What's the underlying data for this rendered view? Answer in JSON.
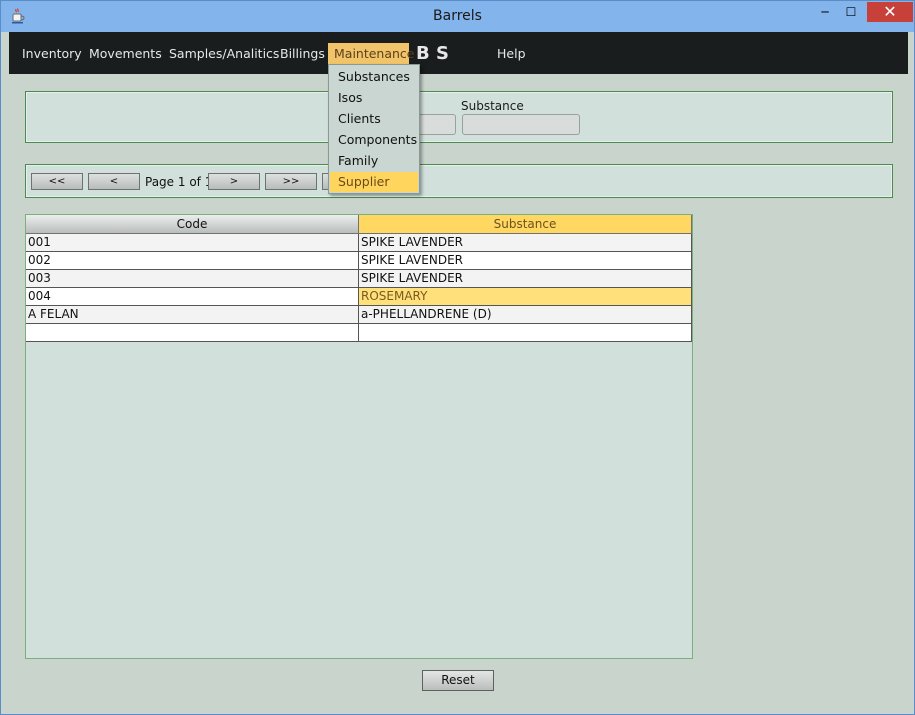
{
  "window": {
    "title": "Barrels",
    "minimize_glyph": "─",
    "maximize_glyph": "☐",
    "close_glyph": "✕",
    "app_icon": "java-cup-icon"
  },
  "menubar": {
    "items": [
      {
        "label": "Inventory"
      },
      {
        "label": "Movements"
      },
      {
        "label": "Samples/Analitics"
      },
      {
        "label": "Billings"
      },
      {
        "label": "Maintenance"
      },
      {
        "label": "Help"
      }
    ],
    "logo_text": "B S",
    "active_color": "#f2c469"
  },
  "dropdown": {
    "items": [
      {
        "label": "Substances"
      },
      {
        "label": "Isos"
      },
      {
        "label": "Clients"
      },
      {
        "label": "Components"
      },
      {
        "label": "Family"
      },
      {
        "label": "Supplier"
      }
    ],
    "hover_index": 5
  },
  "filter": {
    "substance_label": "Substance"
  },
  "pager": {
    "first": "<<",
    "prev": "<",
    "page_text": "Page 1 of 1",
    "next": ">",
    "last": ">>"
  },
  "table": {
    "columns": [
      "Code",
      "Substance"
    ],
    "rows": [
      {
        "code": "001",
        "substance": "SPIKE LAVENDER"
      },
      {
        "code": "002",
        "substance": "SPIKE LAVENDER"
      },
      {
        "code": "003",
        "substance": "SPIKE LAVENDER"
      },
      {
        "code": "004",
        "substance": "ROSEMARY"
      },
      {
        "code": "A FELAN",
        "substance": "a-PHELLANDRENE (D)"
      },
      {
        "code": "",
        "substance": ""
      }
    ],
    "selected_row": 3,
    "selected_color": "#ffe07a"
  },
  "footer": {
    "reset_label": "Reset"
  }
}
